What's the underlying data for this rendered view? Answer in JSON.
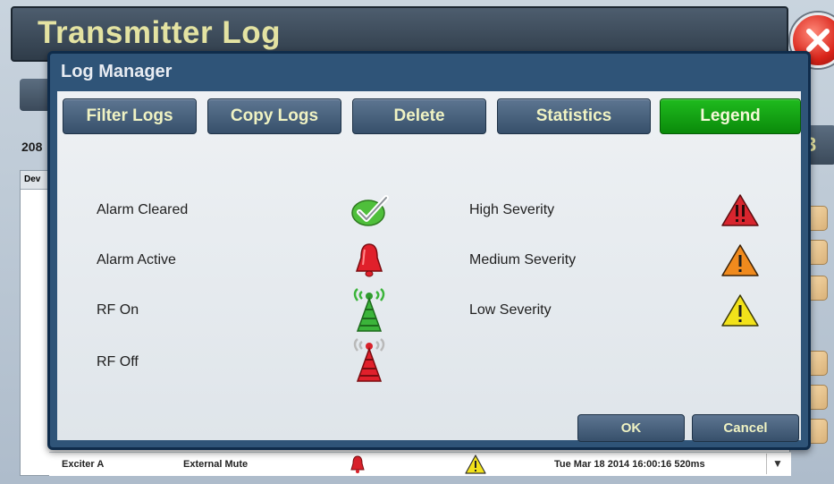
{
  "window": {
    "title": "Transmitter Log"
  },
  "background": {
    "count_text": "208",
    "table_header": "Dev",
    "right_button_text": "3",
    "row": {
      "device": "Exciter A",
      "event": "External Mute",
      "timestamp": "Tue Mar 18 2014 16:00:16 520ms",
      "scroll_glyph": "▼",
      "icons": [
        "alarm-active-icon",
        "low-severity-icon"
      ]
    }
  },
  "dialog": {
    "title": "Log Manager",
    "tabs": [
      {
        "label": "Filter Logs",
        "active": false
      },
      {
        "label": "Copy Logs",
        "active": false
      },
      {
        "label": "Delete",
        "active": false
      },
      {
        "label": "Statistics",
        "active": false
      },
      {
        "label": "Legend",
        "active": true
      }
    ],
    "legend_left": [
      {
        "label": "Alarm Cleared",
        "icon": "checkmark-icon"
      },
      {
        "label": "Alarm Active",
        "icon": "red-bell-icon"
      },
      {
        "label": "RF On",
        "icon": "rf-tower-green-icon"
      },
      {
        "label": "RF Off",
        "icon": "rf-tower-red-icon"
      }
    ],
    "legend_right": [
      {
        "label": "High Severity",
        "icon": "red-warning-icon"
      },
      {
        "label": "Medium Severity",
        "icon": "orange-warning-icon"
      },
      {
        "label": "Low Severity",
        "icon": "yellow-warning-icon"
      }
    ],
    "buttons": {
      "ok": "OK",
      "cancel": "Cancel"
    }
  },
  "colors": {
    "active_tab": "#0a8a0a",
    "tab": "#37506b",
    "dialog_frame": "#2f5478",
    "high_severity": "#d8252e",
    "medium_severity": "#f08a1d",
    "low_severity": "#f2e21a"
  }
}
